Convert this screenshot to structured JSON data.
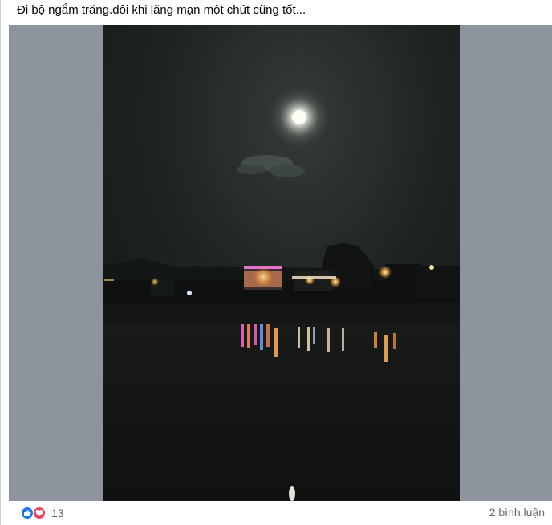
{
  "post": {
    "caption": "Đi bộ ngắm trăng.đôi khi lãng mạn một chút cũng tốt..."
  },
  "photo": {
    "subject": "night-moon-over-river-town"
  },
  "footer": {
    "reaction_icons": [
      "like-icon",
      "love-icon"
    ],
    "reaction_count": "13",
    "comment_count": "2 bình luận"
  },
  "colors": {
    "like_blue": "#1877f2",
    "love_red": "#f33e58",
    "muted_text": "#65676b",
    "media_backdrop": "#8d949e"
  }
}
